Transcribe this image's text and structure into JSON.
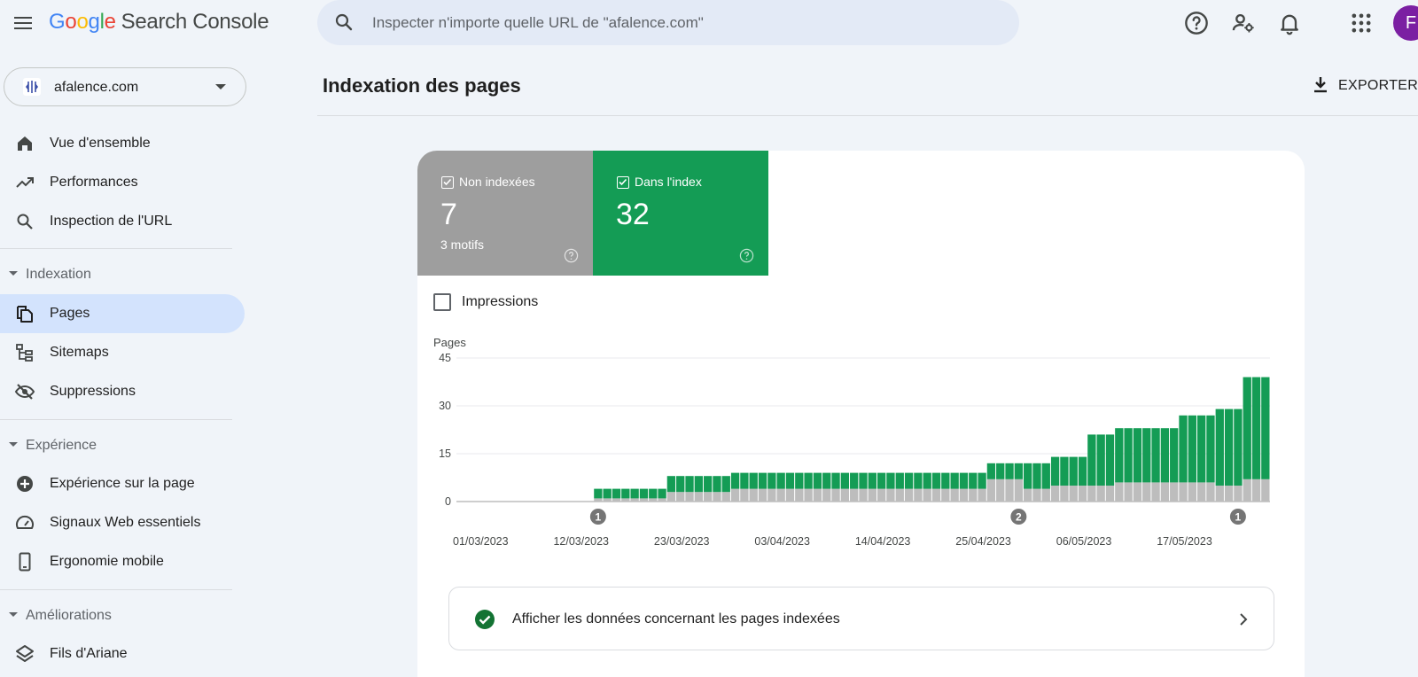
{
  "app": {
    "logo_letters": [
      "G",
      "o",
      "o",
      "g",
      "l",
      "e"
    ],
    "product_name": "Search Console",
    "avatar_letter": "F"
  },
  "search": {
    "placeholder": "Inspecter n'importe quelle URL de \"afalence.com\""
  },
  "topbar_icons": [
    "help-icon",
    "manage-users-icon",
    "notifications-icon",
    "apps-grid-icon"
  ],
  "sidebar": {
    "property": "afalence.com",
    "items_top": [
      {
        "label": "Vue d'ensemble",
        "icon": "home-icon"
      },
      {
        "label": "Performances",
        "icon": "trending-up-icon"
      },
      {
        "label": "Inspection de l'URL",
        "icon": "search-icon"
      }
    ],
    "sections": [
      {
        "label": "Indexation",
        "items": [
          {
            "label": "Pages",
            "icon": "pages-icon",
            "active": true
          },
          {
            "label": "Sitemaps",
            "icon": "sitemap-icon"
          },
          {
            "label": "Suppressions",
            "icon": "visibility-off-icon"
          }
        ]
      },
      {
        "label": "Expérience",
        "items": [
          {
            "label": "Expérience sur la page",
            "icon": "add-circle-icon"
          },
          {
            "label": "Signaux Web essentiels",
            "icon": "speed-icon"
          },
          {
            "label": "Ergonomie mobile",
            "icon": "smartphone-icon"
          }
        ]
      },
      {
        "label": "Améliorations",
        "items": [
          {
            "label": "Fils d'Ariane",
            "icon": "layers-icon"
          }
        ]
      }
    ]
  },
  "main": {
    "title": "Indexation des pages",
    "export_label": "EXPORTER"
  },
  "tiles": {
    "non_indexed": {
      "label": "Non indexées",
      "value": "7",
      "sub": "3 motifs",
      "color": "#9e9e9e"
    },
    "indexed": {
      "label": "Dans l'index",
      "value": "32",
      "color": "#149c55"
    }
  },
  "impressions_label": "Impressions",
  "cta_label": "Afficher les données concernant les pages indexées",
  "chart_data": {
    "type": "bar",
    "stacked": true,
    "ylabel": "Pages",
    "ylim": [
      0,
      45
    ],
    "yticks": [
      0,
      15,
      30,
      45
    ],
    "x_start": "2023-03-01",
    "x_end": "2023-05-28",
    "xtick_labels": [
      "01/03/2023",
      "12/03/2023",
      "23/03/2023",
      "03/04/2023",
      "14/04/2023",
      "25/04/2023",
      "06/05/2023",
      "17/05/2023"
    ],
    "colors": {
      "non_indexed": "#bdbdbd",
      "indexed": "#149c55"
    },
    "annotations": [
      {
        "date": "2023-03-16",
        "label": "1"
      },
      {
        "date": "2023-05-01",
        "label": "2"
      },
      {
        "date": "2023-05-25",
        "label": "1"
      }
    ],
    "segments": [
      {
        "from": "2023-03-01",
        "to": "2023-03-15",
        "non_indexed": 0,
        "indexed": 0
      },
      {
        "from": "2023-03-16",
        "to": "2023-03-23",
        "non_indexed": 1,
        "indexed": 3
      },
      {
        "from": "2023-03-24",
        "to": "2023-03-30",
        "non_indexed": 3,
        "indexed": 5
      },
      {
        "from": "2023-03-31",
        "to": "2023-04-27",
        "non_indexed": 4,
        "indexed": 5
      },
      {
        "from": "2023-04-28",
        "to": "2023-05-01",
        "non_indexed": 7,
        "indexed": 5
      },
      {
        "from": "2023-05-02",
        "to": "2023-05-04",
        "non_indexed": 4,
        "indexed": 8
      },
      {
        "from": "2023-05-05",
        "to": "2023-05-08",
        "non_indexed": 5,
        "indexed": 9
      },
      {
        "from": "2023-05-09",
        "to": "2023-05-11",
        "non_indexed": 5,
        "indexed": 16
      },
      {
        "from": "2023-05-12",
        "to": "2023-05-18",
        "non_indexed": 6,
        "indexed": 17
      },
      {
        "from": "2023-05-19",
        "to": "2023-05-22",
        "non_indexed": 6,
        "indexed": 21
      },
      {
        "from": "2023-05-23",
        "to": "2023-05-25",
        "non_indexed": 5,
        "indexed": 24
      },
      {
        "from": "2023-05-26",
        "to": "2023-05-29",
        "non_indexed": 7,
        "indexed": 32
      }
    ]
  }
}
